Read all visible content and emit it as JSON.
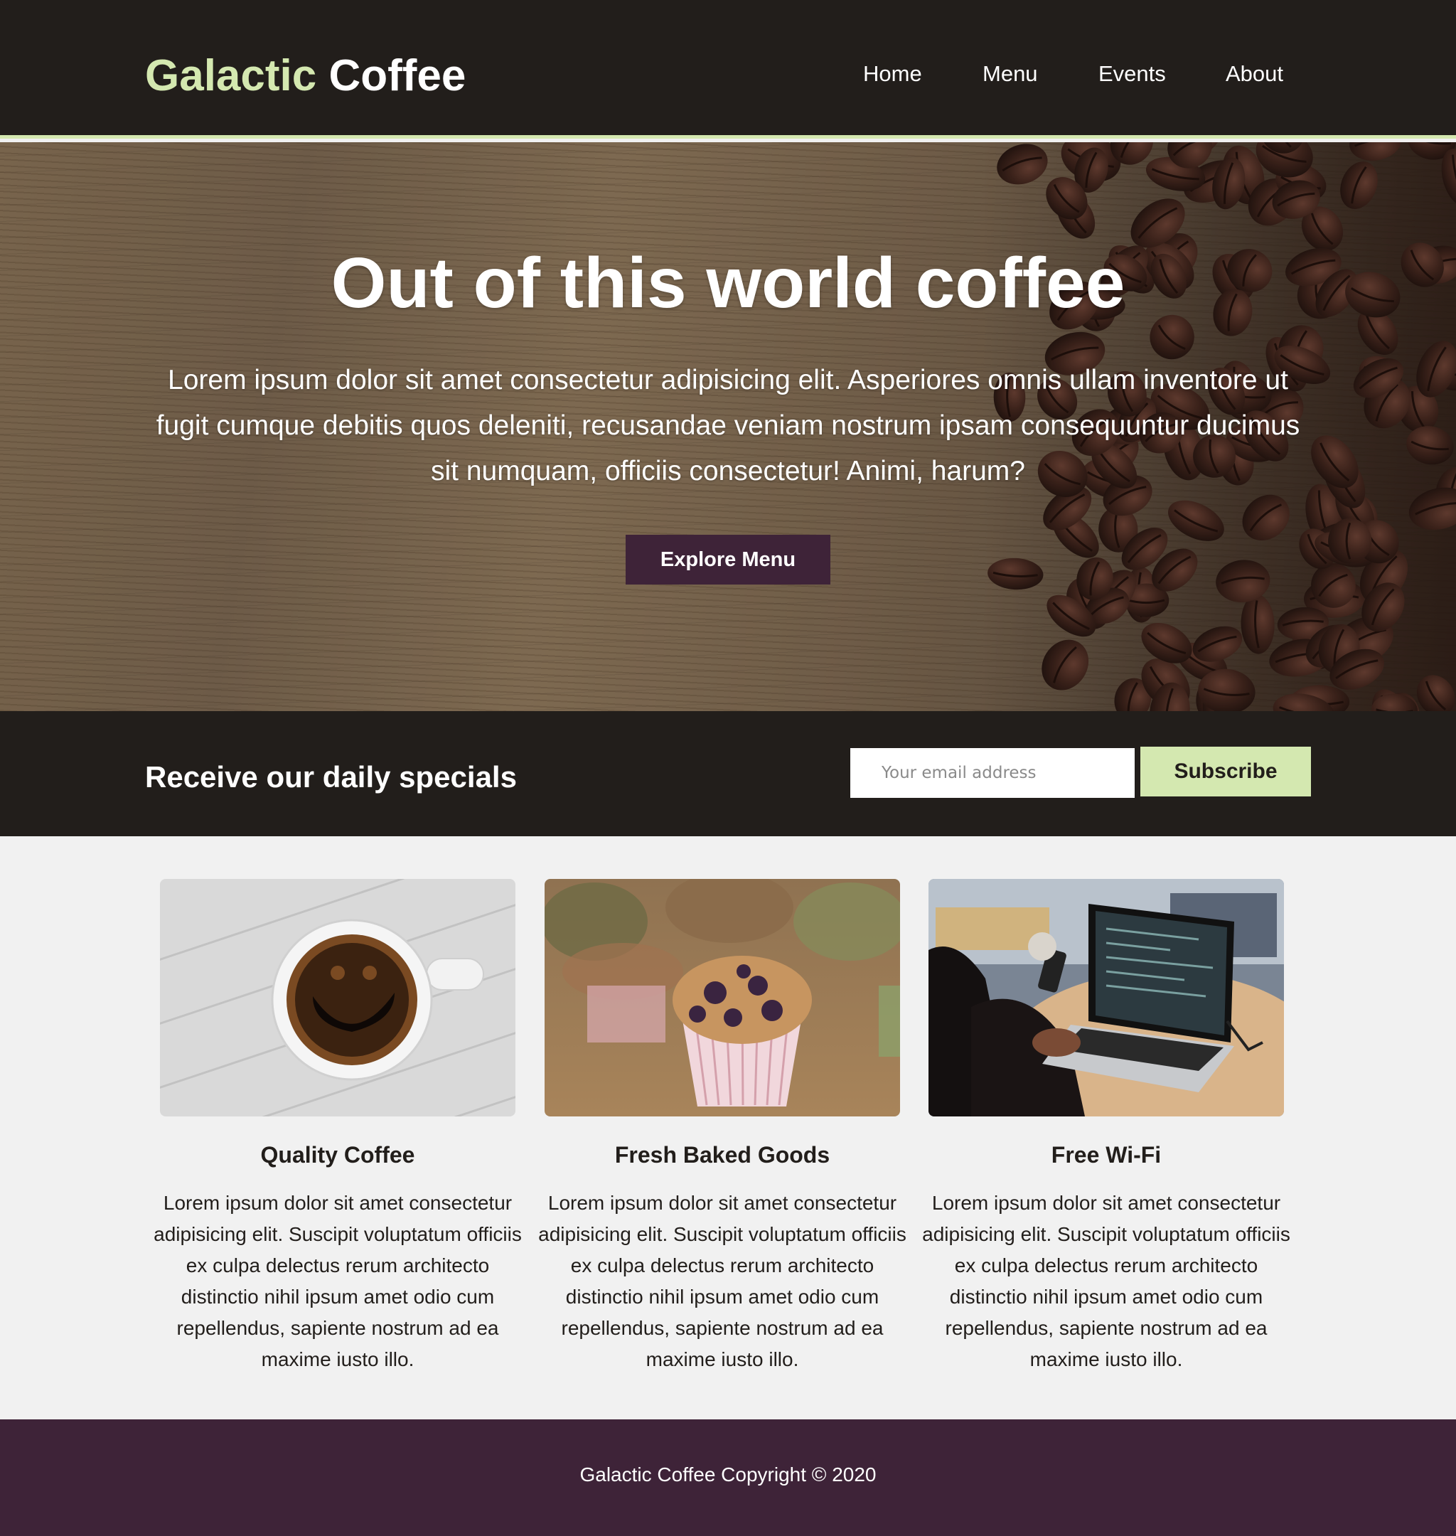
{
  "header": {
    "logo_part1": "Galactic",
    "logo_part2": "Coffee",
    "nav": [
      "Home",
      "Menu",
      "Events",
      "About"
    ]
  },
  "hero": {
    "title": "Out of this world coffee",
    "text": "Lorem ipsum dolor sit amet consectetur adipisicing elit. Asperiores omnis ullam inventore ut fugit cumque debitis quos deleniti, recusandae veniam nostrum ipsam consequuntur ducimus sit numquam, officiis consectetur! Animi, harum?",
    "button": "Explore Menu"
  },
  "newsletter": {
    "title": "Receive our daily specials",
    "email_placeholder": "Your email address",
    "email_value": "",
    "button": "Subscribe"
  },
  "features": [
    {
      "title": "Quality Coffee",
      "text": "Lorem ipsum dolor sit amet consectetur adipisicing elit. Suscipit voluptatum officiis ex culpa delectus rerum architecto distinctio nihil ipsum amet odio cum repellendus, sapiente nostrum ad ea maxime iusto illo."
    },
    {
      "title": "Fresh Baked Goods",
      "text": "Lorem ipsum dolor sit amet consectetur adipisicing elit. Suscipit voluptatum officiis ex culpa delectus rerum architecto distinctio nihil ipsum amet odio cum repellendus, sapiente nostrum ad ea maxime iusto illo."
    },
    {
      "title": "Free Wi-Fi",
      "text": "Lorem ipsum dolor sit amet consectetur adipisicing elit. Suscipit voluptatum officiis ex culpa delectus rerum architecto distinctio nihil ipsum amet odio cum repellendus, sapiente nostrum ad ea maxime iusto illo."
    }
  ],
  "footer": {
    "text": "Galactic Coffee Copyright © 2020"
  },
  "colors": {
    "dark": "#221e1b",
    "accent_green": "#d4e8b0",
    "plum": "#3e2338",
    "light_bg": "#f1f1f1"
  }
}
